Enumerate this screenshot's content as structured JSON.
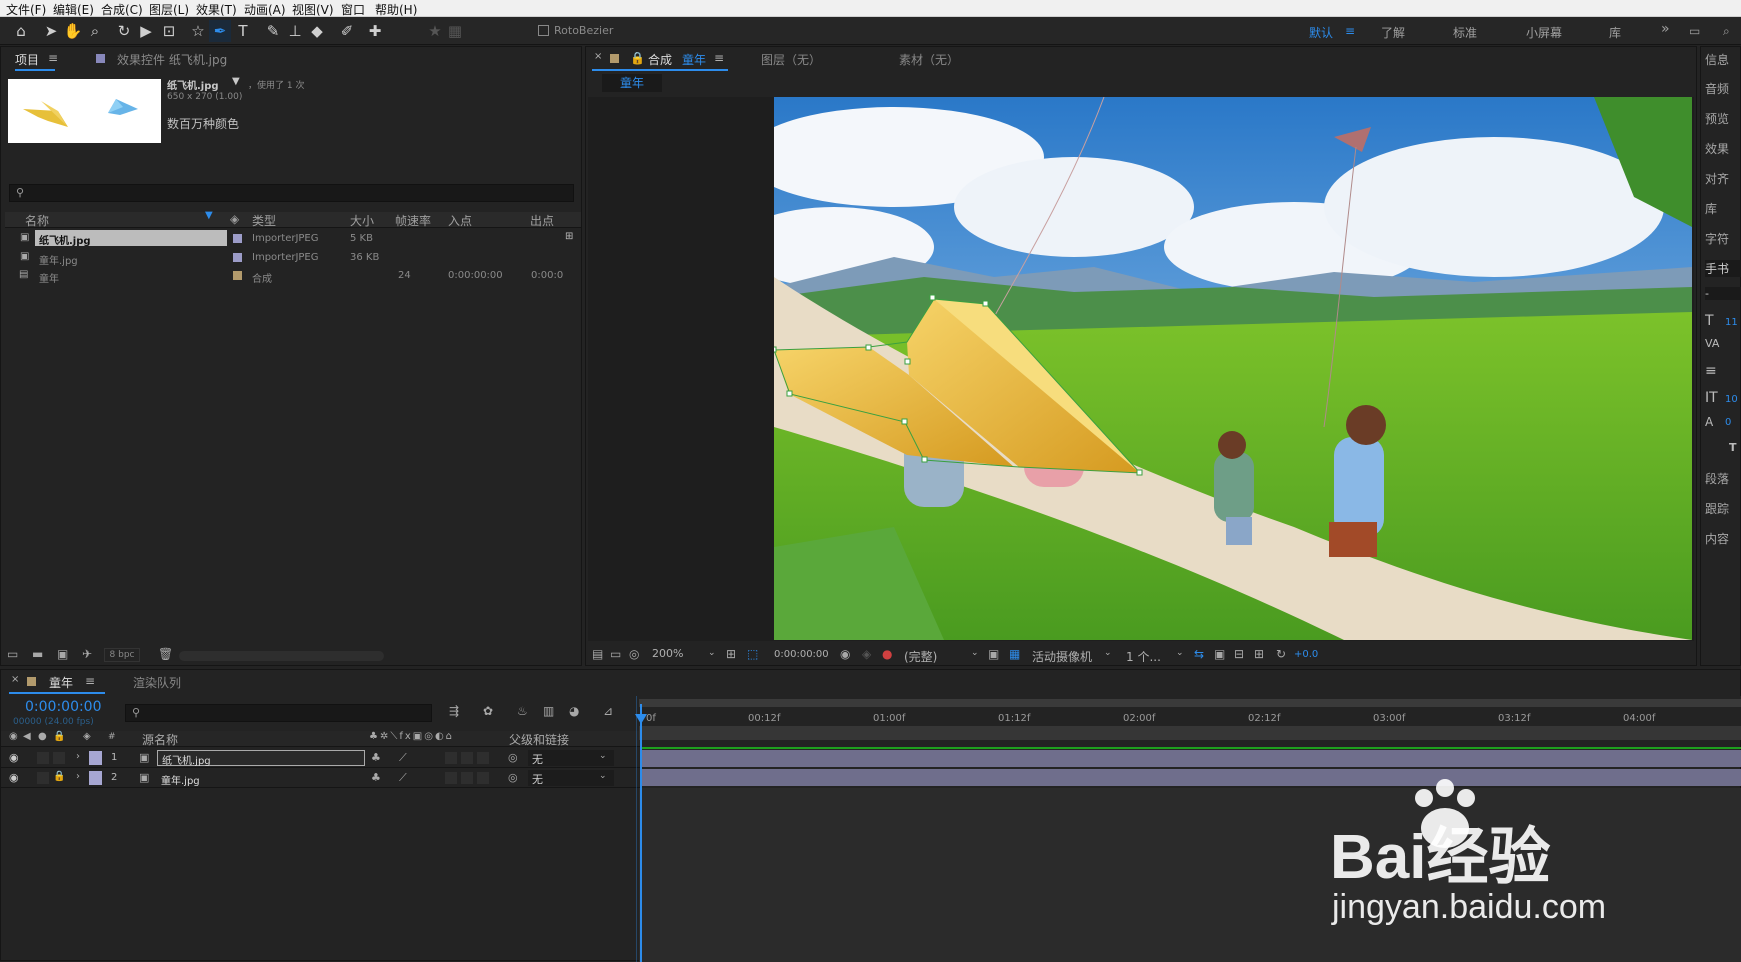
{
  "menu": [
    "文件(F)",
    "编辑(E)",
    "合成(C)",
    "图层(L)",
    "效果(T)",
    "动画(A)",
    "视图(V)",
    "窗口",
    "帮助(H)"
  ],
  "toolbar": {
    "rotobezier": "RotoBezier",
    "workspaces": [
      "默认",
      "了解",
      "标准",
      "小屏幕",
      "库"
    ],
    "more": "»"
  },
  "project": {
    "tab": "项目",
    "effects_tab": "效果控件 纸飞机.jpg",
    "file_name": "纸飞机.jpg",
    "used": "，使用了 1 次",
    "dims": "650 x 270 (1.00)",
    "colors": "数百万种颜色",
    "search_placeholder": "",
    "columns": [
      "名称",
      "类型",
      "大小",
      "帧速率",
      "入点",
      "出点"
    ],
    "items": [
      {
        "name": "纸飞机.jpg",
        "type": "ImporterJPEG",
        "size": "5 KB",
        "fps": "",
        "in": "",
        "out": ""
      },
      {
        "name": "童年.jpg",
        "type": "ImporterJPEG",
        "size": "36 KB",
        "fps": "",
        "in": "",
        "out": ""
      },
      {
        "name": "童年",
        "type": "合成",
        "size": "",
        "fps": "24",
        "in": "0:00:00:00",
        "out": "0:00:0"
      }
    ],
    "bpc": "8 bpc"
  },
  "composition": {
    "tab": "合成",
    "comp_name": "童年",
    "layer_tab": "图层（无）",
    "footage_tab": "素材（无）",
    "sub_tab": "童年",
    "zoom": "200%",
    "timecode": "0:00:00:00",
    "quality": "(完整)",
    "camera": "活动摄像机",
    "views": "1 个...",
    "exposure": "+0.0"
  },
  "right_panel": {
    "items": [
      "信息",
      "音频",
      "预览",
      "效果",
      "对齐",
      "库",
      "字符",
      "手书",
      "段落",
      "跟踪",
      "内容"
    ],
    "values": [
      "-",
      "11",
      "0",
      "10",
      "0"
    ]
  },
  "timeline": {
    "tab": "童年",
    "render_tab": "渲染队列",
    "timecode": "0:00:00:00",
    "fps_info": "00000 (24.00 fps)",
    "col_name": "源名称",
    "col_parent": "父级和链接",
    "layers": [
      {
        "num": "1",
        "name": "纸飞机.jpg",
        "parent": "无"
      },
      {
        "num": "2",
        "name": "童年.jpg",
        "parent": "无"
      }
    ],
    "ruler": [
      "0f",
      "00:12f",
      "01:00f",
      "01:12f",
      "02:00f",
      "02:12f",
      "03:00f",
      "03:12f",
      "04:00f"
    ]
  },
  "watermark": {
    "brand": "Bai经验",
    "url": "jingyan.baidu.com"
  },
  "colors": {
    "accent": "#2d8ceb",
    "bg": "#232323",
    "menu_bg": "#f0f0f0",
    "layer_bar": "#6f6e8c",
    "green_line": "#1ea01e"
  }
}
